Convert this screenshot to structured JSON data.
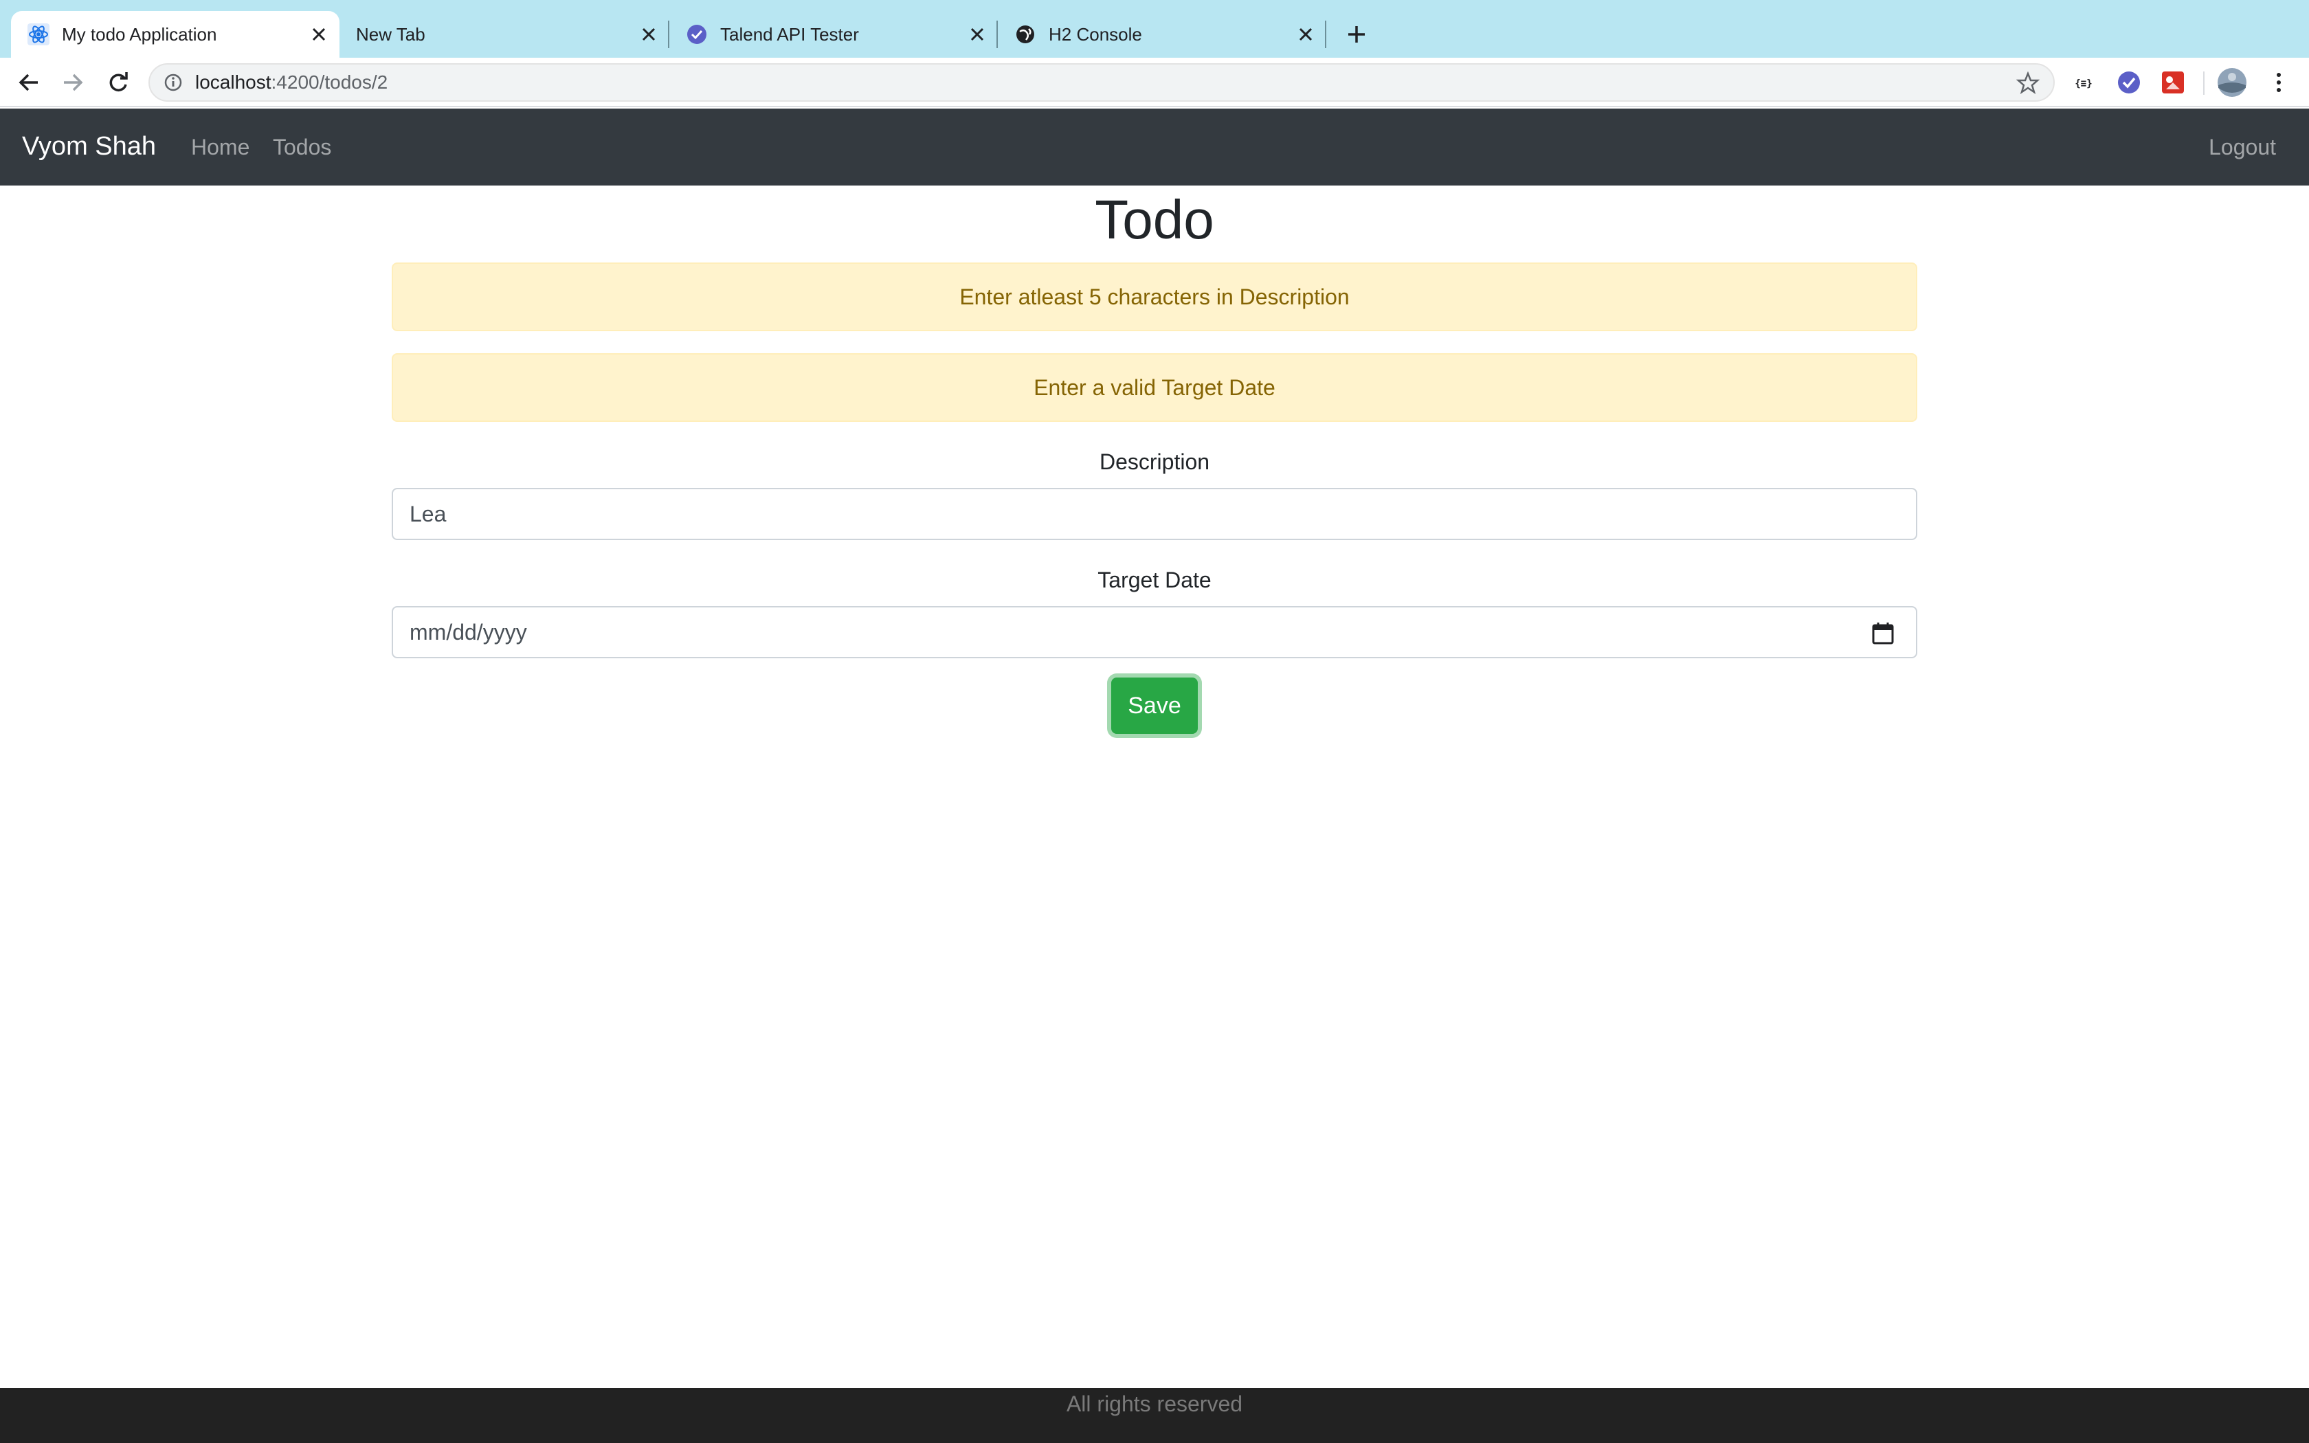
{
  "browser": {
    "tabs": [
      {
        "title": "My todo Application",
        "icon": "react-icon",
        "active": true
      },
      {
        "title": "New Tab",
        "icon": "",
        "active": false
      },
      {
        "title": "Talend API Tester",
        "icon": "talend-check-icon",
        "active": false
      },
      {
        "title": "H2 Console",
        "icon": "globe-icon",
        "active": false
      }
    ],
    "url_host": "localhost",
    "url_path": ":4200/todos/2",
    "extensions": [
      "json-formatter-icon",
      "talend-check-icon",
      "red-extension-icon"
    ],
    "colors": {
      "tabstrip": "#b8e6f2",
      "omnibox": "#f1f3f4"
    }
  },
  "navbar": {
    "brand": "Vyom Shah",
    "links": [
      "Home",
      "Todos"
    ],
    "logout": "Logout",
    "background": "#343a40"
  },
  "main": {
    "title": "Todo",
    "alerts": [
      "Enter atleast 5 characters in Description",
      "Enter a valid Target Date"
    ],
    "description_label": "Description",
    "description_value": "Lea",
    "target_date_label": "Target Date",
    "target_date_placeholder": "mm/dd/yyyy",
    "save_label": "Save",
    "colors": {
      "alert_bg": "#fff3cd",
      "alert_text": "#856404",
      "save": "#28a745"
    }
  },
  "footer": {
    "text": "All rights reserved"
  }
}
